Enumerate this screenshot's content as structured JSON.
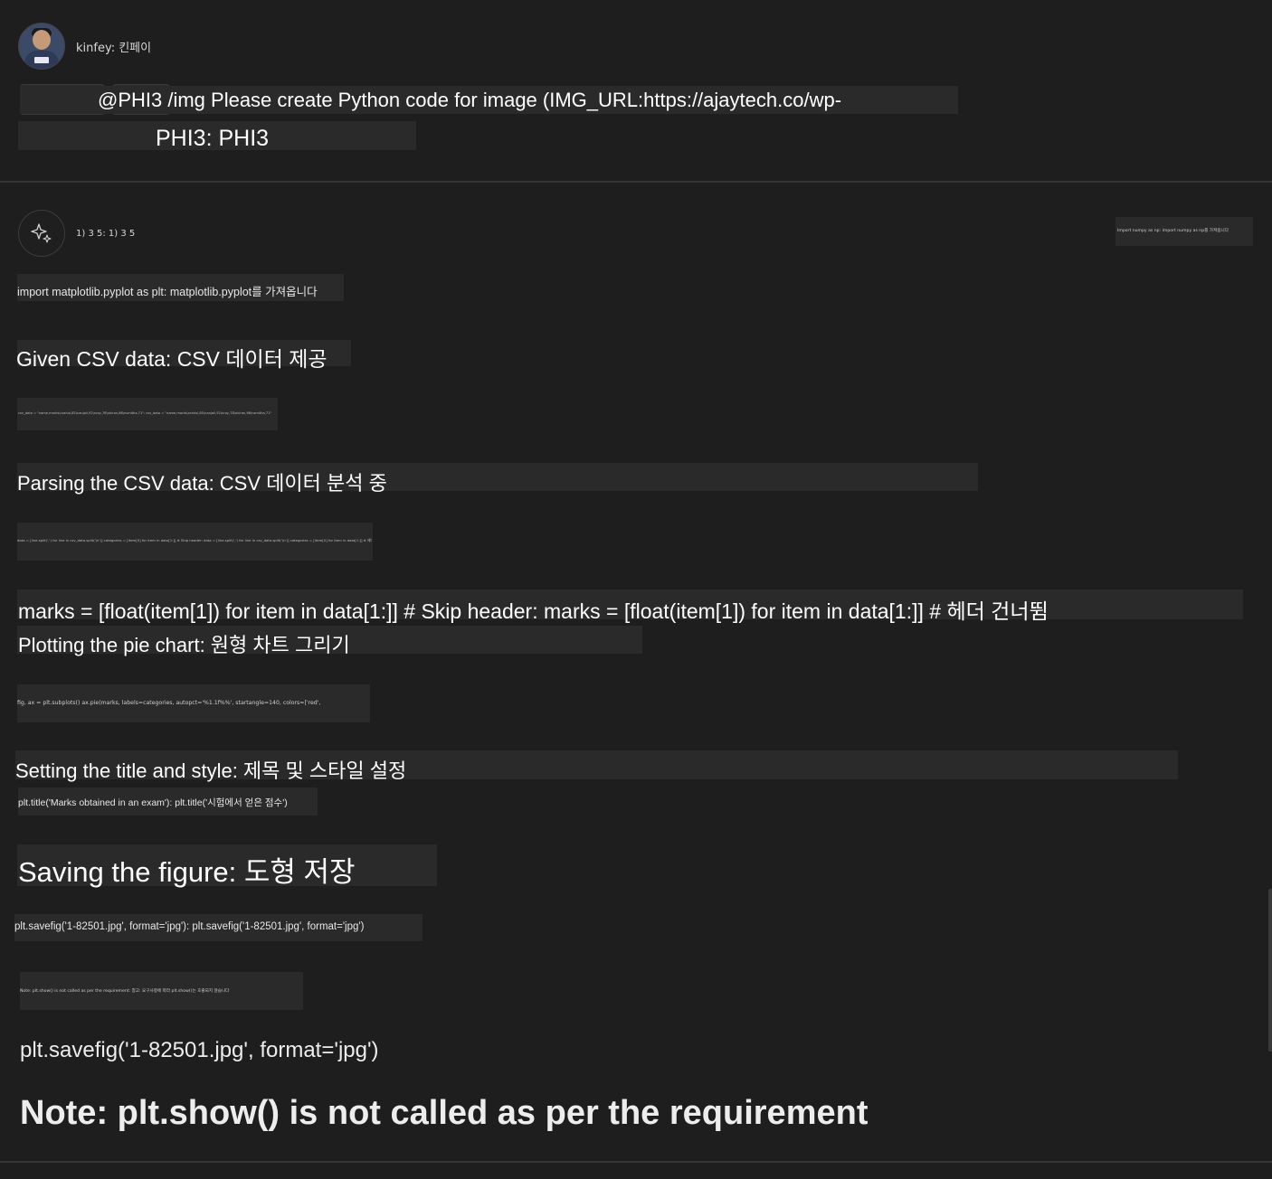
{
  "user": {
    "name": "kinfey: 킨페이",
    "prompt": "@PHI3 /img Please create Python code for image (IMG_URL:https://ajaytech.co/wp-",
    "agent_ref": "PHI3: PHI3"
  },
  "bot": {
    "header": "1) 3 5: 1) 3 5",
    "top_right_snippet": "Import numpy as np: import numpy as np를 가져옵니다",
    "lines": {
      "import_line": "import matplotlib.pyplot as plt: matplotlib.pyplot를 가져옵니다",
      "given_heading": "Given CSV data: CSV 데이터 제공",
      "csv_snippet": "csv_data = \"name,marks\\nrahul,85\\nanjali,92\\nroy,78\\nkiran,66\\nsmitha,71\": csv_data = \"name,marks\\nrahul,85\\nanjali,92\\nroy,78\\nkiran,66\\nsmitha,71\"",
      "parsing_heading": "Parsing the CSV data: CSV 데이터 분석 중",
      "parse_snippet": "data = [line.split(',') for line in csv_data.split('\\n')] categories = [item[0] for item in data[1:]] # Skip header: data = [line.split(',') for line in csv_data.split('\\n')] categories = [item[0] for item in data[1:]] # 헤더 건너뜀",
      "marks_line": "marks = [float(item[1]) for item in data[1:]] # Skip header: marks = [float(item[1]) for item in data[1:]] # 헤더 건너뜀",
      "plotting_heading": "Plotting the pie chart: 원형 차트 그리기",
      "pie_snippet": "fig, ax = plt.subplots() ax.pie(marks, labels=categories, autopct='%1.1f%%', startangle=140, colors=['red',",
      "title_heading": "Setting the title and style: 제목 및 스타일 설정",
      "title_code": "plt.title('Marks obtained in an exam'): plt.title('시험에서 얻은 점수')",
      "saving_heading": "Saving the figure: 도형 저장",
      "save_code": "plt.savefig('1-82501.jpg', format='jpg'): plt.savefig('1-82501.jpg', format='jpg')",
      "note_snippet": "Note: plt.show() is not called as per the requirement: 참고: 요구사항에 따라 plt.show()는 호출되지 않습니다",
      "save_code_plain": "plt.savefig('1-82501.jpg', format='jpg')",
      "note_plain": "Note: plt.show() is not called as per the requirement"
    }
  },
  "icons": {
    "bot_avatar": "sparkle-icon"
  }
}
